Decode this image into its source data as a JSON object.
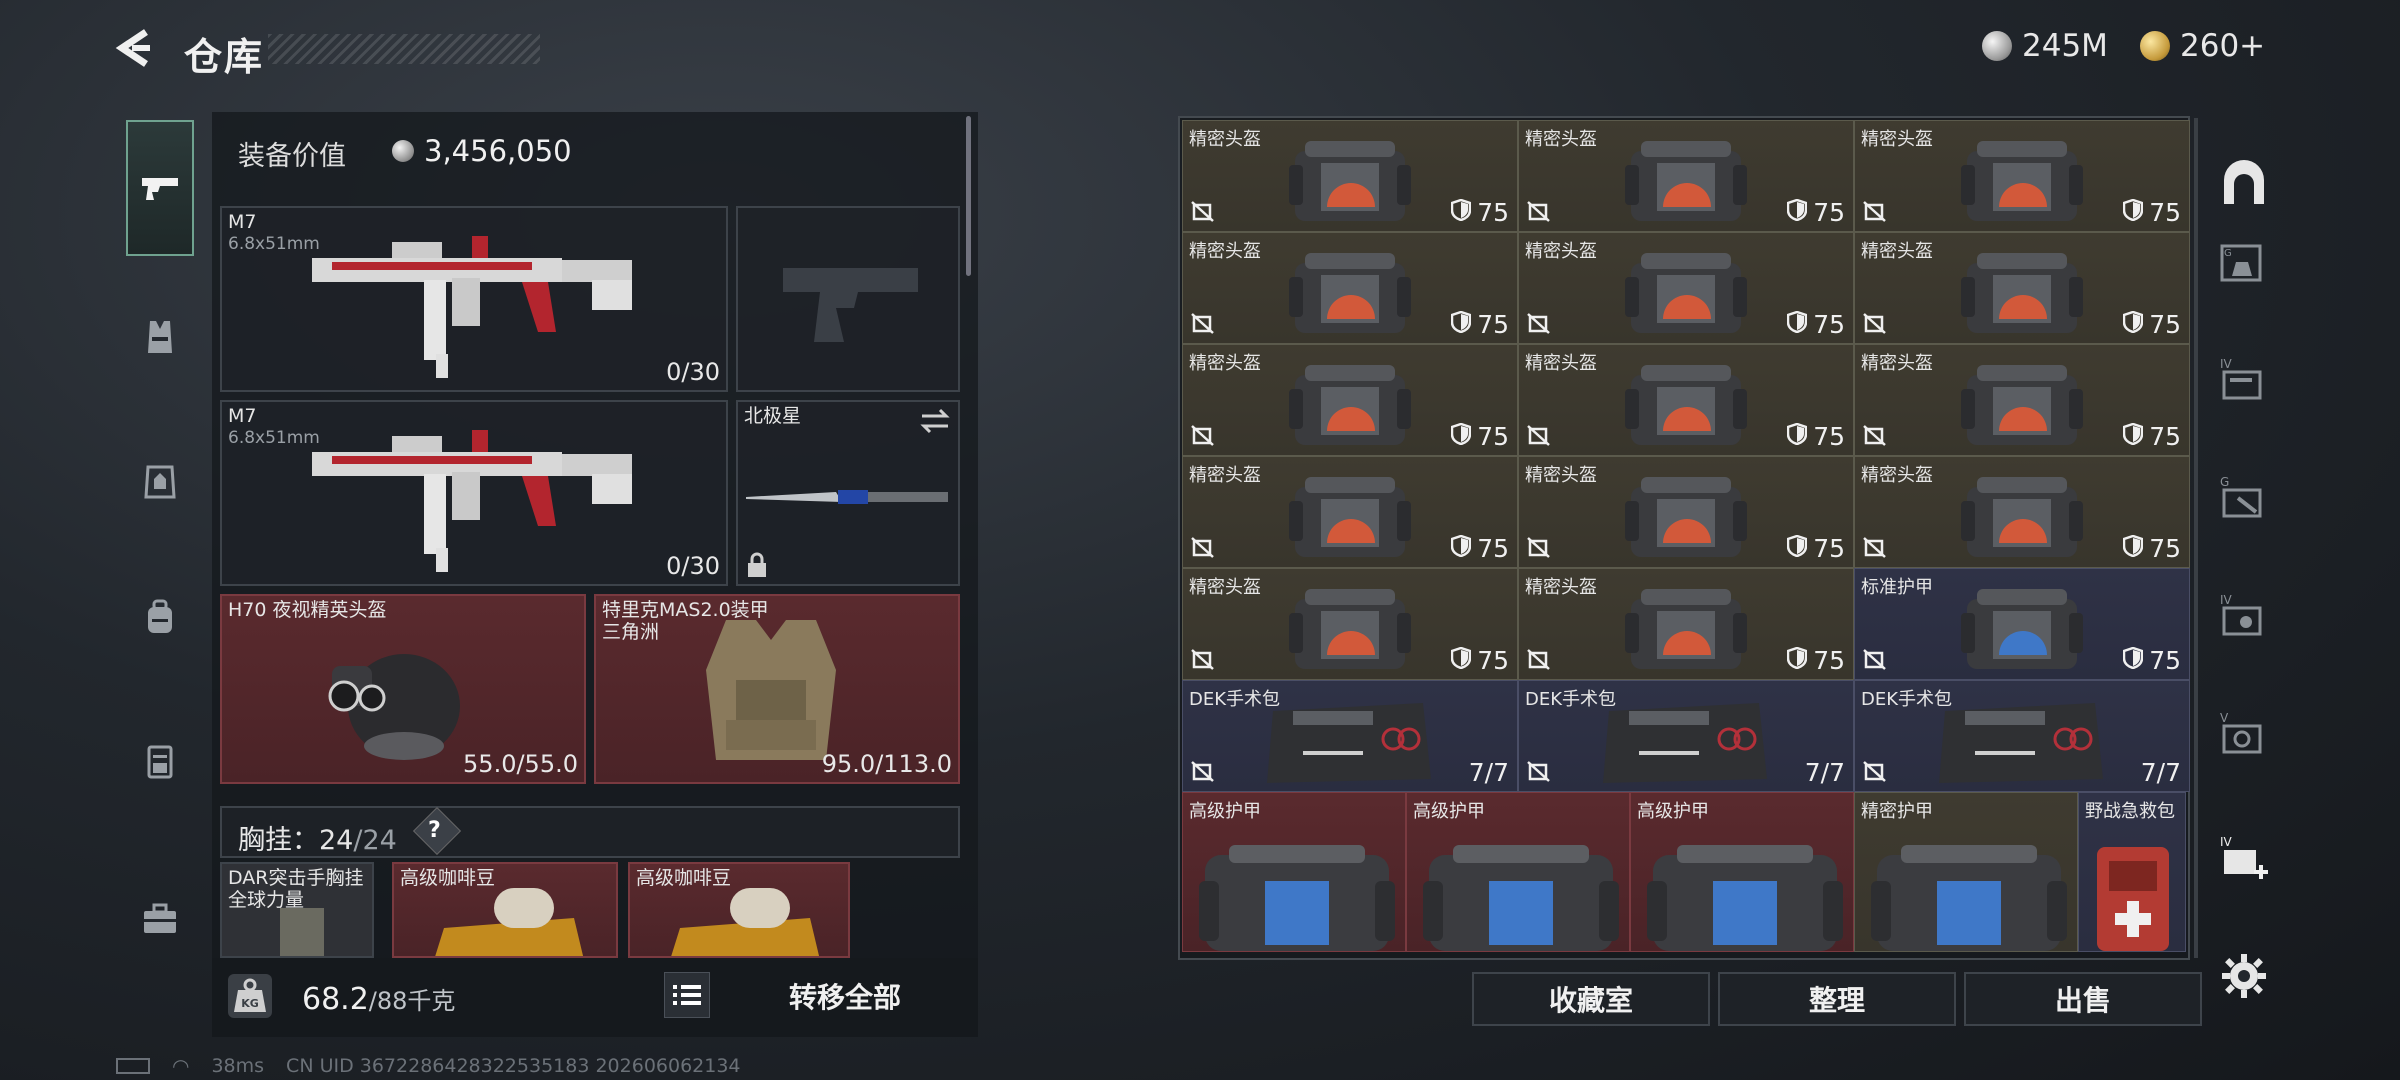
{
  "header": {
    "title": "仓库",
    "currency_silver": "245M",
    "currency_gold": "260+"
  },
  "colors": {
    "cell_olive": "#3f3b30",
    "cell_blue": "#2f3246",
    "cell_red": "#5a2a2e",
    "accent_green": "#6fa28f"
  },
  "left_tabs": [
    "pistol-icon",
    "vest-icon",
    "armor-icon",
    "backpack-icon",
    "pouch-icon",
    "case-icon"
  ],
  "equipment": {
    "value_label": "装备价值",
    "value": "3,456,050",
    "primary1": {
      "name": "M7",
      "caliber": "6.8x51mm",
      "ammo": "0/30"
    },
    "primary2": {
      "name": "M7",
      "caliber": "6.8x51mm",
      "ammo": "0/30"
    },
    "melee": {
      "name": "北极星"
    },
    "helmet": {
      "name": "H70 夜视精英头盔",
      "durability": "55.0/55.0"
    },
    "armor": {
      "name": "特里克MAS2.0装甲",
      "name2": "三角洲",
      "durability": "95.0/113.0"
    },
    "chest_rig": {
      "label": "胸挂：",
      "used": "24",
      "sep": "/",
      "total": "24",
      "q": "?"
    },
    "rig_items": [
      {
        "name": "DAR突击手胸挂",
        "name2": "全球力量"
      },
      {
        "name": "高级咖啡豆"
      },
      {
        "name": "高级咖啡豆"
      }
    ],
    "weight": "68.2",
    "weight_max": "/88千克",
    "transfer_label": "转移全部"
  },
  "storage": {
    "rows": [
      [
        {
          "name": "精密头盔",
          "val": "75",
          "kind": "helmet"
        },
        {
          "name": "精密头盔",
          "val": "75",
          "kind": "helmet"
        },
        {
          "name": "精密头盔",
          "val": "75",
          "kind": "helmet"
        }
      ],
      [
        {
          "name": "精密头盔",
          "val": "75",
          "kind": "helmet"
        },
        {
          "name": "精密头盔",
          "val": "75",
          "kind": "helmet"
        },
        {
          "name": "精密头盔",
          "val": "75",
          "kind": "helmet"
        }
      ],
      [
        {
          "name": "精密头盔",
          "val": "75",
          "kind": "helmet"
        },
        {
          "name": "精密头盔",
          "val": "75",
          "kind": "helmet"
        },
        {
          "name": "精密头盔",
          "val": "75",
          "kind": "helmet"
        }
      ],
      [
        {
          "name": "精密头盔",
          "val": "75",
          "kind": "helmet"
        },
        {
          "name": "精密头盔",
          "val": "75",
          "kind": "helmet"
        },
        {
          "name": "精密头盔",
          "val": "75",
          "kind": "helmet"
        }
      ],
      [
        {
          "name": "精密头盔",
          "val": "75",
          "kind": "helmet"
        },
        {
          "name": "精密头盔",
          "val": "75",
          "kind": "helmet"
        },
        {
          "name": "标准护甲",
          "val": "75",
          "kind": "blue"
        }
      ],
      [
        {
          "name": "DEK手术包",
          "val": "7/7",
          "kind": "medkit"
        },
        {
          "name": "DEK手术包",
          "val": "7/7",
          "kind": "medkit"
        },
        {
          "name": "DEK手术包",
          "val": "7/7",
          "kind": "medkit"
        }
      ]
    ],
    "bottom_row": [
      {
        "name": "高级护甲",
        "kind": "red"
      },
      {
        "name": "高级护甲",
        "kind": "red"
      },
      {
        "name": "高级护甲",
        "kind": "red"
      },
      {
        "name": "精密护甲",
        "kind": "olive"
      },
      {
        "name": "野战急救包",
        "kind": "blue"
      }
    ],
    "buttons": {
      "collection": "收藏室",
      "sort": "整理",
      "sell": "出售"
    }
  },
  "status": {
    "ping": "38ms",
    "uid": "CN UID 3672286428322535183 202606062134"
  }
}
